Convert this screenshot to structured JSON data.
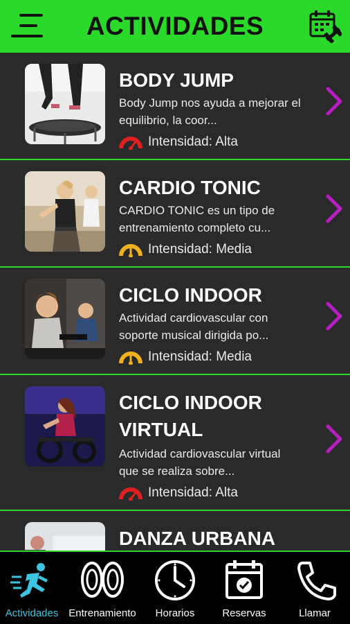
{
  "header": {
    "title": "ACTIVIDADES",
    "menu_icon": "hamburger-menu-icon",
    "calendar_icon": "calendar-dumbbell-icon",
    "accent_color": "#2bd92b"
  },
  "activities": [
    {
      "title": "BODY JUMP",
      "description": "Body Jump nos ayuda a mejorar el equilibrio, la coor...",
      "intensity": "Intensidad: Alta",
      "intensity_color": "#e02020"
    },
    {
      "title": "CARDIO TONIC",
      "description": "CARDIO TONIC es un tipo de entrenamiento completo cu...",
      "intensity": "Intensidad: Media",
      "intensity_color": "#f0b020"
    },
    {
      "title": "CICLO INDOOR",
      "description": "Actividad cardiovascular con soporte musical dirigida po...",
      "intensity": "Intensidad: Media",
      "intensity_color": "#f0b020"
    },
    {
      "title": "CICLO INDOOR VIRTUAL",
      "description": "Actividad cardiovascular virtual que se realiza sobre...",
      "intensity": "Intensidad: Alta",
      "intensity_color": "#e02020"
    },
    {
      "title": "DANZA URBANA",
      "description": "",
      "intensity": ""
    }
  ],
  "tabs": [
    {
      "label": "Actividades",
      "icon": "running-man-icon",
      "active": true
    },
    {
      "label": "Entrenamiento",
      "icon": "weight-plates-icon",
      "active": false
    },
    {
      "label": "Horarios",
      "icon": "clock-icon",
      "active": false
    },
    {
      "label": "Reservas",
      "icon": "calendar-check-icon",
      "active": false
    },
    {
      "label": "Llamar",
      "icon": "phone-icon",
      "active": false
    }
  ],
  "colors": {
    "active_tab": "#3ec3e0",
    "chevron": "#b61fc0",
    "background": "#2a2a2a"
  }
}
